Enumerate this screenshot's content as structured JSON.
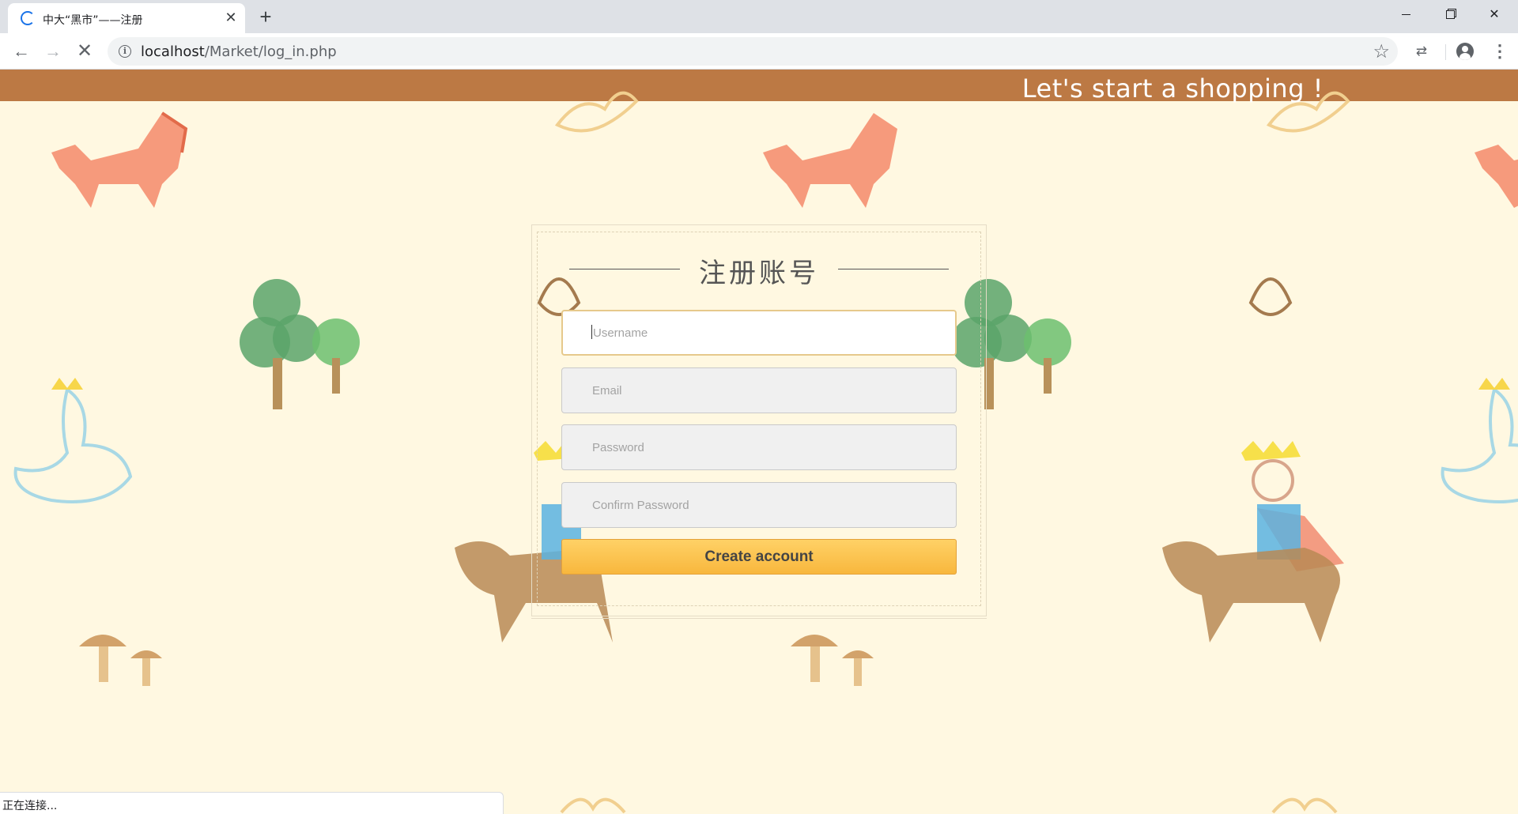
{
  "browser": {
    "tab_title": "中大“黑市”——注册",
    "url_host": "localhost",
    "url_path": "/Market/log_in.php",
    "status_text": "正在连接..."
  },
  "page": {
    "banner_text": "Let's start a shopping !",
    "register": {
      "title": "注册账号",
      "username_placeholder": "Username",
      "email_placeholder": "Email",
      "password_placeholder": "Password",
      "confirm_placeholder": "Confirm Password",
      "submit_label": "Create account"
    }
  },
  "colors": {
    "banner": "#bc7944",
    "background": "#fff8e1",
    "button": "#f8b73d"
  }
}
